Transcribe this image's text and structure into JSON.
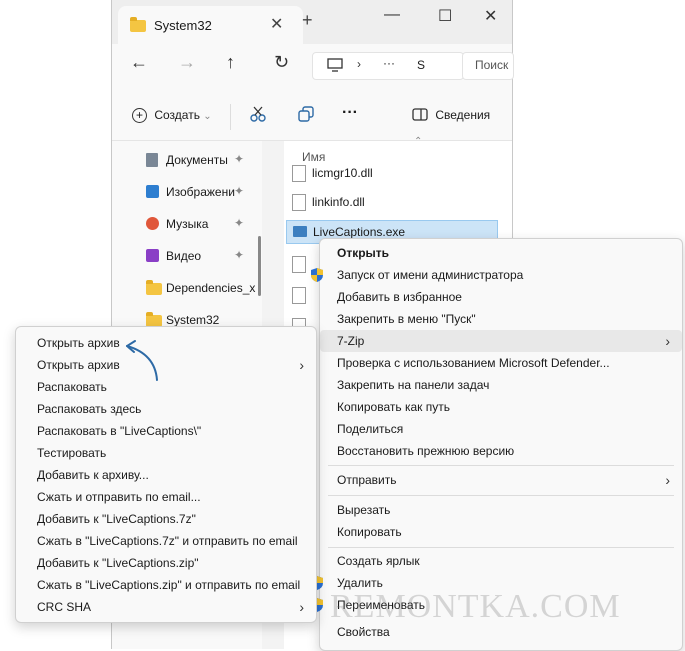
{
  "window": {
    "tab_title": "System32",
    "tab_close": "✕",
    "new_tab": "+",
    "minimize": "—",
    "maximize": "☐",
    "close": "✕"
  },
  "address": {
    "back": "←",
    "forward": "→",
    "up": "↑",
    "refresh": "↻",
    "ellipsis": "···",
    "crumb": "S",
    "search_placeholder": "Поиск"
  },
  "toolbar": {
    "create_label": "Создать",
    "more": "···",
    "details_label": "Сведения"
  },
  "navpane": {
    "items": [
      {
        "label": "Документы",
        "icon": "documents-icon",
        "pinned": true
      },
      {
        "label": "Изображени",
        "icon": "pictures-icon",
        "pinned": true
      },
      {
        "label": "Музыка",
        "icon": "music-icon",
        "pinned": true
      },
      {
        "label": "Видео",
        "icon": "video-icon",
        "pinned": true
      },
      {
        "label": "Dependencies_x",
        "icon": "folder-icon",
        "pinned": false
      },
      {
        "label": "System32",
        "icon": "folder-icon",
        "pinned": false
      }
    ]
  },
  "files": {
    "column_name": "Имя",
    "items": [
      "licmgr10.dll",
      "linkinfo.dll",
      "LiveCaptions.exe"
    ]
  },
  "context_menu": {
    "items": [
      {
        "label": "Открыть",
        "bold": true
      },
      {
        "label": "Запуск от имени администратора",
        "icon": "uac-shield-icon"
      },
      {
        "label": "Добавить в избранное"
      },
      {
        "label": "Закрепить в меню \"Пуск\""
      },
      {
        "label": "7-Zip",
        "submenu": true,
        "highlighted": true
      },
      {
        "label": "Проверка с использованием Microsoft Defender..."
      },
      {
        "label": "Закрепить на панели задач"
      },
      {
        "label": "Копировать как путь"
      },
      {
        "label": "Поделиться"
      },
      {
        "label": "Восстановить прежнюю версию"
      },
      {
        "label": "Отправить",
        "submenu": true
      },
      {
        "label": "Вырезать"
      },
      {
        "label": "Копировать"
      },
      {
        "label": "Создать ярлык"
      },
      {
        "label": "Удалить"
      },
      {
        "label": "Переименовать"
      },
      {
        "label": "Свойства"
      }
    ]
  },
  "zip_submenu": {
    "items": [
      {
        "label": "Открыть архив"
      },
      {
        "label": "Открыть архив",
        "submenu": true
      },
      {
        "label": "Распаковать"
      },
      {
        "label": "Распаковать здесь"
      },
      {
        "label": "Распаковать в \"LiveCaptions\\\""
      },
      {
        "label": "Тестировать"
      },
      {
        "label": "Добавить к архиву..."
      },
      {
        "label": "Сжать и отправить по email..."
      },
      {
        "label": "Добавить к \"LiveCaptions.7z\""
      },
      {
        "label": "Сжать в \"LiveCaptions.7z\" и отправить по email"
      },
      {
        "label": "Добавить к \"LiveCaptions.zip\""
      },
      {
        "label": "Сжать в \"LiveCaptions.zip\" и отправить по email"
      },
      {
        "label": "CRC SHA",
        "submenu": true
      }
    ]
  },
  "watermark": "REMONTKA.COM",
  "colors": {
    "accent_arrow": "#2d6aa6",
    "selection": "#cce4f7",
    "folder": "#f4c542"
  }
}
